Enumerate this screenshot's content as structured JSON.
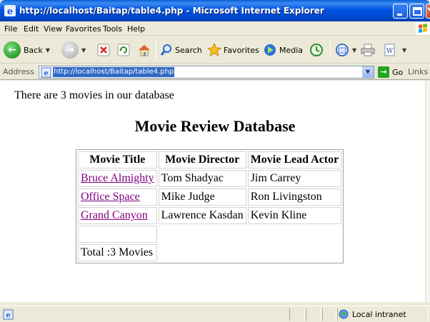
{
  "window": {
    "title": "http://localhost/Baitap/table4.php - Microsoft Internet Explorer"
  },
  "menu": {
    "items": [
      "File",
      "Edit",
      "View",
      "Favorites",
      "Tools",
      "Help"
    ]
  },
  "toolbar": {
    "back_label": "Back",
    "search_label": "Search",
    "favorites_label": "Favorites",
    "media_label": "Media"
  },
  "address": {
    "label": "Address",
    "url": "http://localhost/Baitap/table4.php",
    "go_label": "Go",
    "links_label": "Links"
  },
  "page": {
    "count_text": "There are 3 movies in our database",
    "heading": "Movie Review Database",
    "table": {
      "headers": [
        "Movie Title",
        "Movie Director",
        "Movie Lead Actor"
      ],
      "rows": [
        {
          "title": "Bruce Almighty",
          "director": "Tom Shadyac",
          "actor": "Jim Carrey"
        },
        {
          "title": "Office Space",
          "director": "Mike Judge",
          "actor": "Ron Livingston"
        },
        {
          "title": "Grand Canyon",
          "director": "Lawrence Kasdan",
          "actor": "Kevin Kline"
        }
      ],
      "total": "Total :3 Movies"
    }
  },
  "status": {
    "zone": "Local intranet"
  },
  "colors": {
    "titlebar": "#0054e3",
    "link_visited": "#800080",
    "selection": "#316ac5"
  }
}
